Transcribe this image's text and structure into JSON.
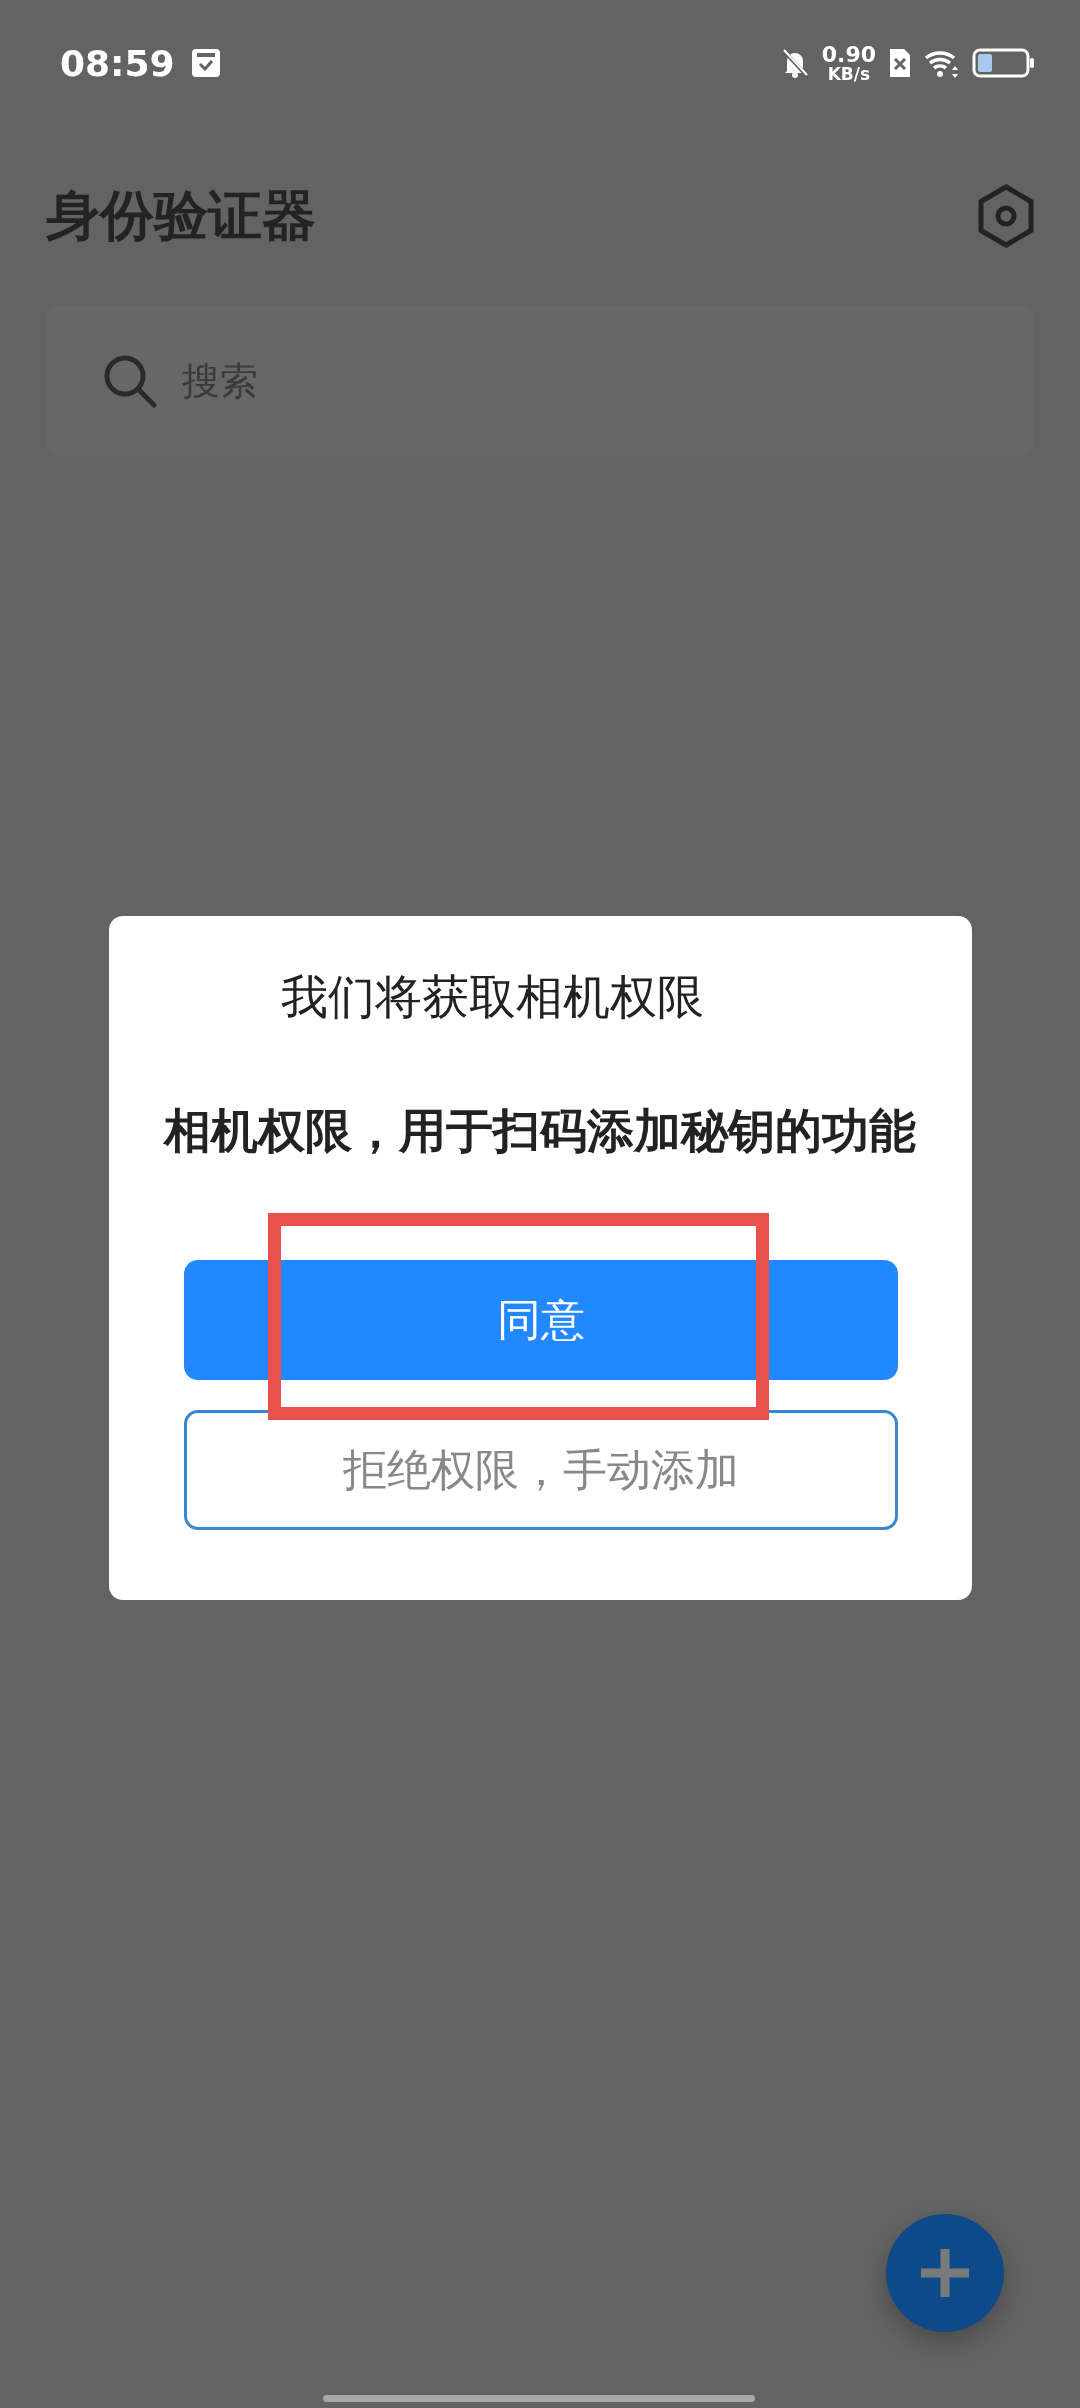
{
  "status_bar": {
    "time": "08:59",
    "net_speed": "0.90",
    "net_unit": "KB/s"
  },
  "header": {
    "title": "身份验证器"
  },
  "search": {
    "placeholder": "搜索"
  },
  "dialog": {
    "title": "我们将获取相机权限",
    "message": "相机权限，用于扫码添加秘钥的功能",
    "highlight_frame": true,
    "buttons": [
      {
        "label": "同意",
        "kind": "primary"
      },
      {
        "label": "拒绝权限，手动添加",
        "kind": "outline"
      }
    ]
  }
}
